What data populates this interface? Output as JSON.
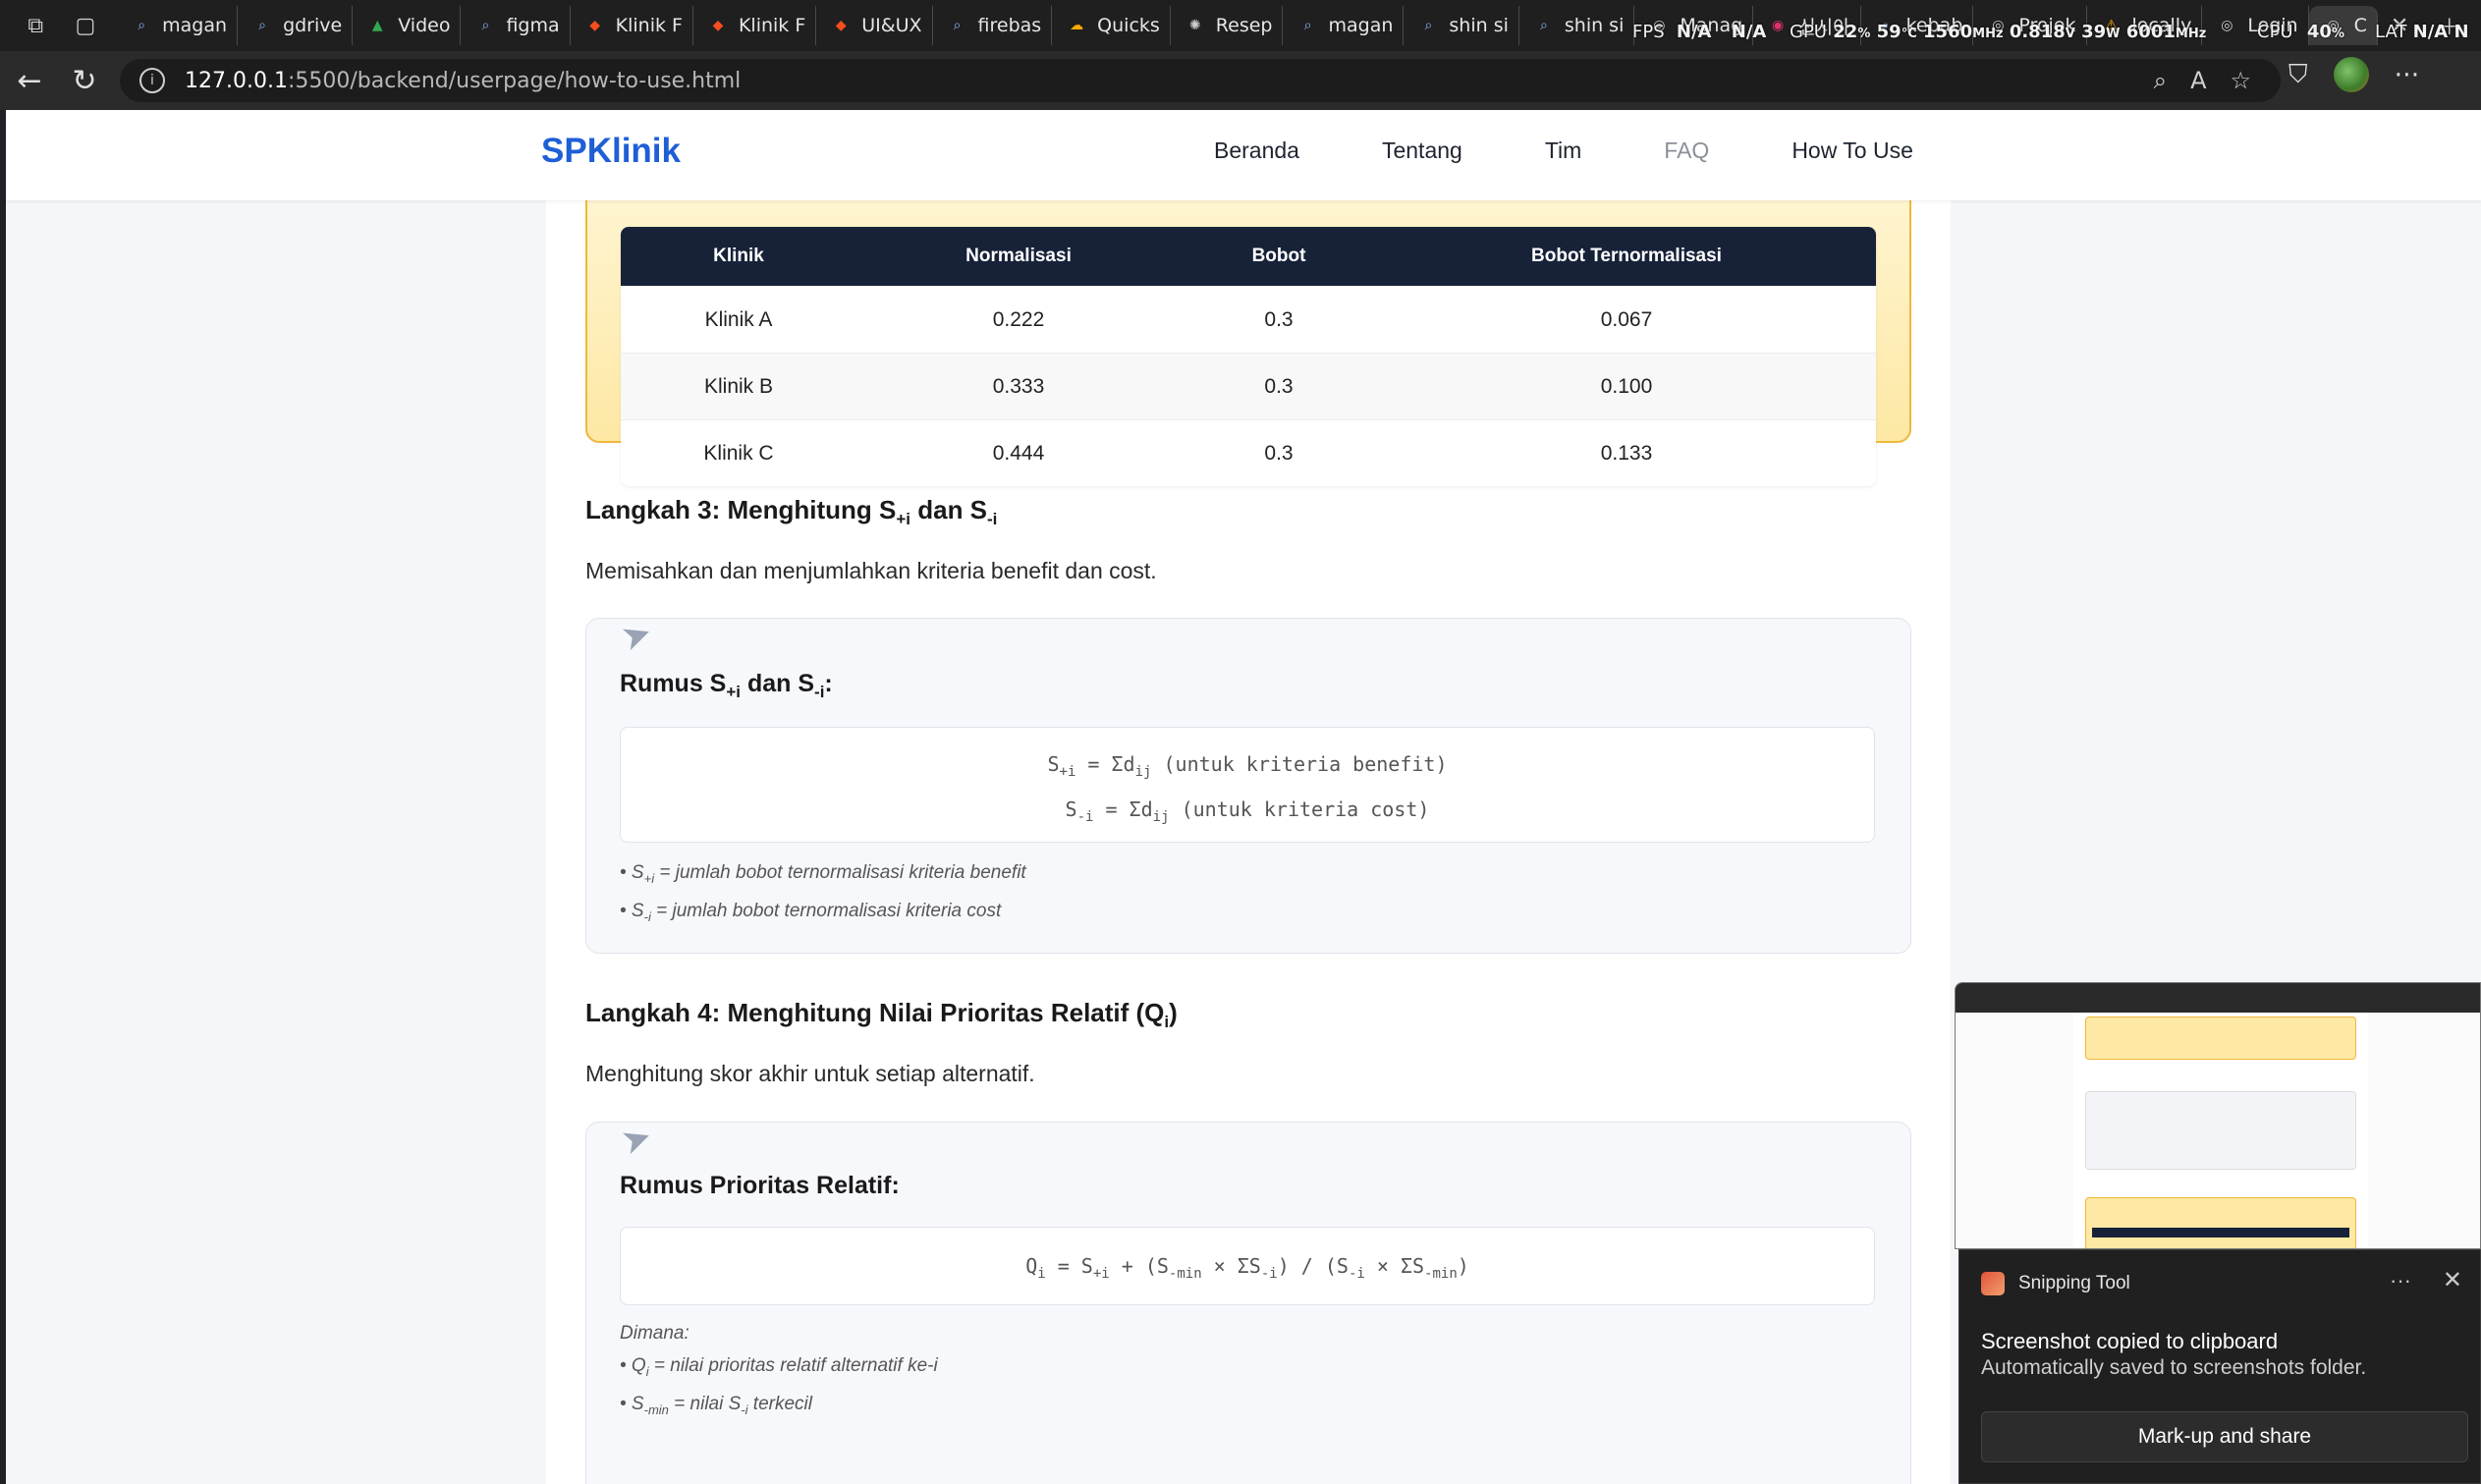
{
  "browser": {
    "tabs": [
      {
        "label": "magan",
        "icon": "search-icon"
      },
      {
        "label": "gdrive",
        "icon": "search-icon"
      },
      {
        "label": "Video",
        "icon": "drive-icon"
      },
      {
        "label": "figma",
        "icon": "search-icon"
      },
      {
        "label": "Klinik F",
        "icon": "figma-icon"
      },
      {
        "label": "Klinik F",
        "icon": "figma-icon"
      },
      {
        "label": "UI&UX",
        "icon": "figma-icon"
      },
      {
        "label": "firebas",
        "icon": "search-icon"
      },
      {
        "label": "Quicks",
        "icon": "cloud-icon"
      },
      {
        "label": "Resep",
        "icon": "openai-icon"
      },
      {
        "label": "magan",
        "icon": "search-icon"
      },
      {
        "label": "shin si",
        "icon": "search-icon"
      },
      {
        "label": "shin si",
        "icon": "search-icon"
      },
      {
        "label": "Manag",
        "icon": "globe-icon"
      },
      {
        "label": "신시아",
        "icon": "instagram-icon"
      },
      {
        "label": "kebab",
        "icon": "search-icon"
      },
      {
        "label": "Projek",
        "icon": "globe-icon"
      },
      {
        "label": "locally",
        "icon": "warning-icon"
      },
      {
        "label": "Login",
        "icon": "globe-icon"
      },
      {
        "label": "C",
        "icon": "globe-icon"
      }
    ],
    "hud": {
      "fps_label": "FPS",
      "fps_a": "N/A",
      "fps_b": "N/A",
      "gpu_label": "GPU",
      "gpu_pct": "22",
      "gpu_pct_unit": "%",
      "gpu_temp": "59",
      "gpu_temp_unit": "°C",
      "gpu_clock": "1560",
      "gpu_clock_unit": "MHz",
      "gpu_volt": "0.818",
      "gpu_volt_unit": "V",
      "gpu_watt": "39",
      "gpu_watt_unit": "W",
      "mem_clock": "6001",
      "mem_clock_unit": "MHz",
      "cpu_label": "CPU",
      "cpu_pct": "40",
      "cpu_pct_unit": "%",
      "lat_label": "LAT",
      "lat_a": "N/A",
      "lat_b": "N"
    },
    "url_host": "127.0.0.1",
    "url_path": ":5500/backend/userpage/how-to-use.html"
  },
  "site": {
    "brand": "SPKlinik",
    "menu": [
      {
        "label": "Beranda",
        "color": "#1e2430"
      },
      {
        "label": "Tentang",
        "color": "#1e2430"
      },
      {
        "label": "Tim",
        "color": "#1e2430"
      },
      {
        "label": "FAQ",
        "color": "#8a8f99"
      },
      {
        "label": "How To Use",
        "color": "#1e2430"
      }
    ]
  },
  "table": {
    "headers": [
      "Klinik",
      "Normalisasi",
      "Bobot",
      "Bobot Ternormalisasi"
    ],
    "rows": [
      [
        "Klinik A",
        "0.222",
        "0.3",
        "0.067"
      ],
      [
        "Klinik B",
        "0.333",
        "0.3",
        "0.100"
      ],
      [
        "Klinik C",
        "0.444",
        "0.3",
        "0.133"
      ]
    ]
  },
  "step3": {
    "title_pre": "Langkah 3: Menghitung S",
    "title_sub1": "+i",
    "title_mid": " dan S",
    "title_sub2": "-i",
    "desc": "Memisahkan dan menjumlahkan kriteria benefit dan cost.",
    "formula_title_pre": "Rumus S",
    "formula_title_sub1": "+i",
    "formula_title_mid": " dan S",
    "formula_title_sub2": "-i",
    "formula_title_post": ":",
    "line1": {
      "a": "S",
      "a_sub": "+i",
      "b": " = Σd",
      "b_sub": "ij",
      "c": " (untuk kriteria benefit)"
    },
    "line2": {
      "a": "S",
      "a_sub": "-i",
      "b": " = Σd",
      "b_sub": "ij",
      "c": " (untuk kriteria cost)"
    },
    "note1": {
      "pre": "• S",
      "sub": "+i",
      "post": " = jumlah bobot ternormalisasi kriteria benefit"
    },
    "note2": {
      "pre": "• S",
      "sub": "-i",
      "post": " = jumlah bobot ternormalisasi kriteria cost"
    }
  },
  "step4": {
    "title_pre": "Langkah 4: Menghitung Nilai Prioritas Relatif (Q",
    "title_sub": "i",
    "title_post": ")",
    "desc": "Menghitung skor akhir untuk setiap alternatif.",
    "formula_title": "Rumus Prioritas Relatif:",
    "formula": {
      "p1": "Q",
      "s1": "i",
      "p2": " = S",
      "s2": "+i",
      "p3": " + (S",
      "s3": "-min",
      "p4": " × ΣS",
      "s4": "-i",
      "p5": ") / (S",
      "s5": "-i",
      "p6": " × ΣS",
      "s6": "-min",
      "p7": ")"
    },
    "notes_head": "Dimana:",
    "note1": {
      "pre": "• Q",
      "sub": "i",
      "post": " = nilai prioritas relatif alternatif ke-i"
    },
    "note2": {
      "pre": "• S",
      "sub": "-min",
      "post": " = nilai S",
      "sub2": "-i",
      "post2": " terkecil"
    }
  },
  "snipping": {
    "app": "Snipping Tool",
    "title": "Screenshot copied to clipboard",
    "subtitle": "Automatically saved to screenshots folder.",
    "action": "Mark-up and share"
  }
}
